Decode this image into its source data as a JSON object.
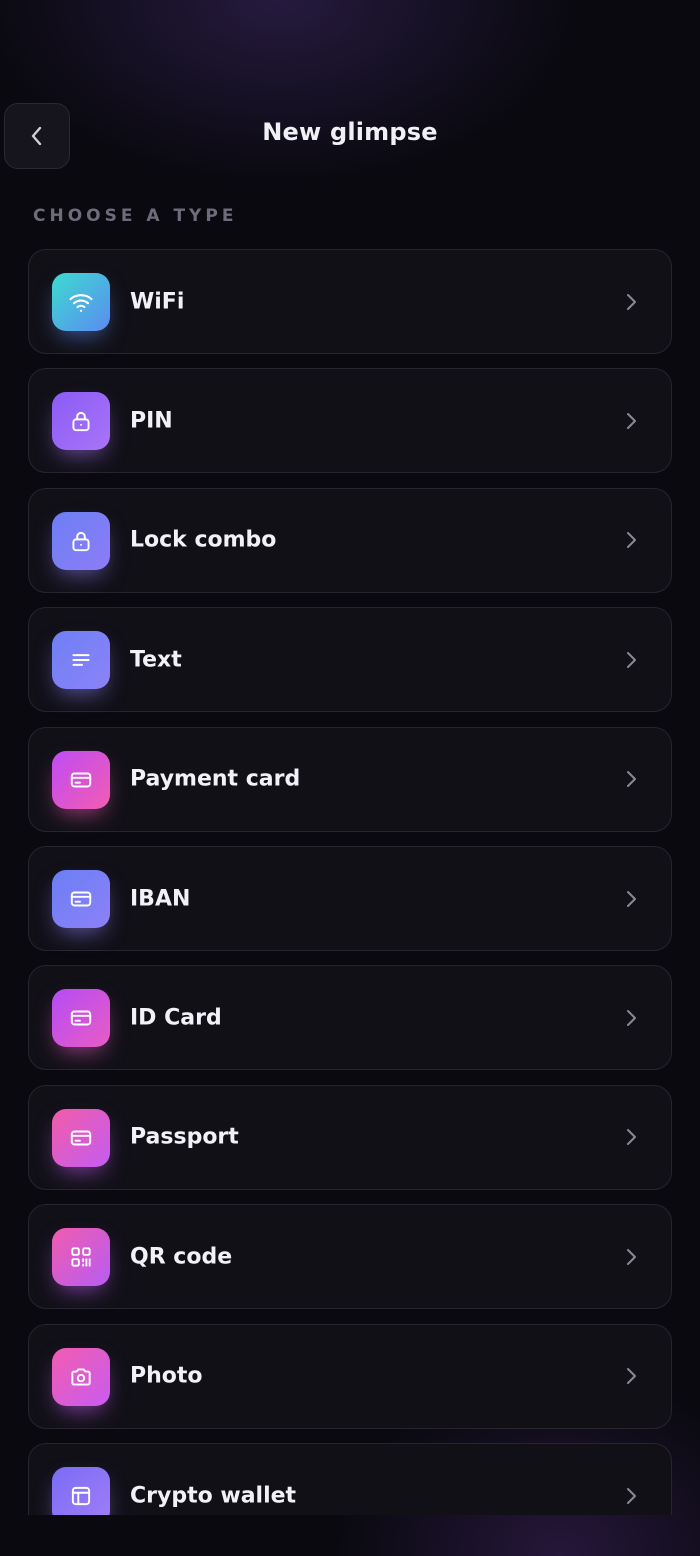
{
  "header": {
    "title": "New glimpse"
  },
  "section": {
    "label": "CHOOSE A TYPE"
  },
  "items": [
    {
      "id": "wifi",
      "label": "WiFi",
      "icon": "wifi-icon",
      "gradient": [
        "#3ddbd0",
        "#5b8bf2"
      ]
    },
    {
      "id": "pin",
      "label": "PIN",
      "icon": "lock-icon",
      "gradient": [
        "#8b5cf6",
        "#a874f7"
      ]
    },
    {
      "id": "lock-combo",
      "label": "Lock combo",
      "icon": "lock-icon",
      "gradient": [
        "#6c7ef5",
        "#8d7df6"
      ]
    },
    {
      "id": "text",
      "label": "Text",
      "icon": "text-lines-icon",
      "gradient": [
        "#6f80f6",
        "#8c82f7"
      ]
    },
    {
      "id": "payment-card",
      "label": "Payment card",
      "icon": "card-icon",
      "gradient": [
        "#c04cf5",
        "#f25cb2"
      ]
    },
    {
      "id": "iban",
      "label": "IBAN",
      "icon": "card-icon",
      "gradient": [
        "#6a7ff6",
        "#8e80f7"
      ]
    },
    {
      "id": "id-card",
      "label": "ID Card",
      "icon": "card-icon",
      "gradient": [
        "#b54cf5",
        "#e85cc4"
      ]
    },
    {
      "id": "passport",
      "label": "Passport",
      "icon": "card-icon",
      "gradient": [
        "#f25ca8",
        "#c35cf2"
      ]
    },
    {
      "id": "qr-code",
      "label": "QR code",
      "icon": "qr-icon",
      "gradient": [
        "#f05cae",
        "#b85cf4"
      ]
    },
    {
      "id": "photo",
      "label": "Photo",
      "icon": "camera-icon",
      "gradient": [
        "#f25cb0",
        "#c85cf0"
      ]
    },
    {
      "id": "crypto-wallet",
      "label": "Crypto wallet",
      "icon": "wallet-icon",
      "gradient": [
        "#7a6cf6",
        "#a07df7"
      ]
    }
  ],
  "colors": {
    "background": "#0a0910",
    "card": "#111017",
    "card_border": "#26252e",
    "label": "#f2f1f7",
    "section_label": "#6e6c7a",
    "chevron": "#8a8896"
  }
}
